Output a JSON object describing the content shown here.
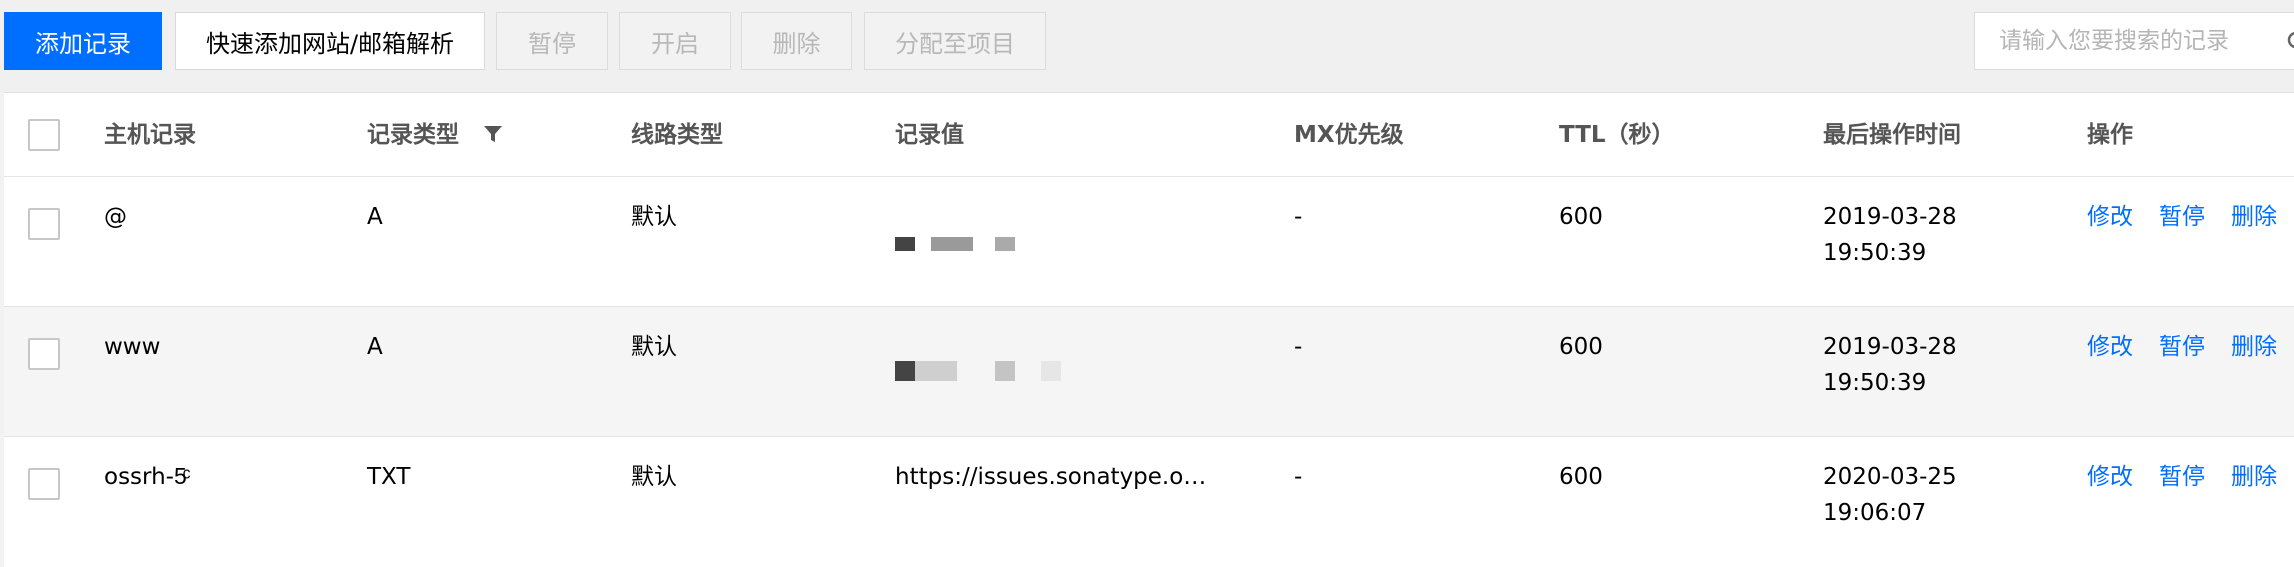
{
  "toolbar": {
    "add_record": "添加记录",
    "quick_add": "快速添加网站/邮箱解析",
    "pause": "暂停",
    "start": "开启",
    "delete": "删除",
    "assign_project": "分配至项目"
  },
  "search": {
    "placeholder": "请输入您要搜索的记录"
  },
  "table": {
    "headers": {
      "host": "主机记录",
      "type": "记录类型",
      "line": "线路类型",
      "value": "记录值",
      "mx": "MX优先级",
      "ttl": "TTL（秒）",
      "last_modified": "最后操作时间",
      "actions": "操作"
    },
    "rows": [
      {
        "host": "@",
        "type": "A",
        "line": "默认",
        "value": "",
        "mx": "-",
        "ttl": "600",
        "date": "2019-03-28",
        "time": "19:50:39",
        "op_edit": "修改",
        "op_pause": "暂停",
        "op_delete": "删除"
      },
      {
        "host": "www",
        "type": "A",
        "line": "默认",
        "value": "",
        "mx": "-",
        "ttl": "600",
        "date": "2019-03-28",
        "time": "19:50:39",
        "op_edit": "修改",
        "op_pause": "暂停",
        "op_delete": "删除"
      },
      {
        "host": "ossrh-5ͨ",
        "type": "TXT",
        "line": "默认",
        "value": "https://issues.sonatype.o…",
        "mx": "-",
        "ttl": "600",
        "date": "2020-03-25",
        "time": "19:06:07",
        "op_edit": "修改",
        "op_pause": "暂停",
        "op_delete": "删除"
      }
    ]
  },
  "colors": {
    "primary": "#006eff",
    "link": "#006eff",
    "disabled_text": "#b8b8b8"
  },
  "icons": {
    "filter": "filter-icon",
    "search": "search-icon"
  }
}
